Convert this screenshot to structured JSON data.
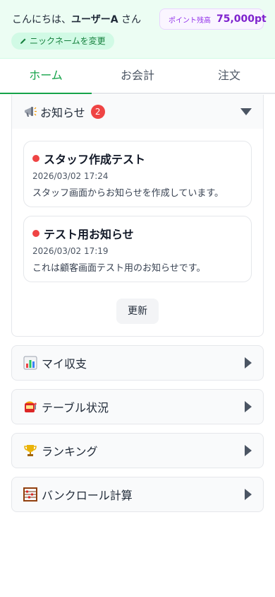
{
  "header": {
    "greeting_prefix": "こんにちは、",
    "user_name": "ユーザーA",
    "greeting_suffix": " さん",
    "nickname_button": "ニックネームを変更",
    "points_label": "ポイント残高",
    "points_value": "75,000pt"
  },
  "tabs": [
    {
      "label": "ホーム",
      "active": true
    },
    {
      "label": "お会計",
      "active": false
    },
    {
      "label": "注文",
      "active": false
    }
  ],
  "notices": {
    "title": "お知らせ",
    "count": "2",
    "items": [
      {
        "title": "スタッフ作成テスト",
        "date": "2026/03/02 17:24",
        "body": "スタッフ画面からお知らせを作成しています。"
      },
      {
        "title": "テスト用お知らせ",
        "date": "2026/03/02 17:19",
        "body": "これは顧客画面テスト用のお知らせです。"
      }
    ],
    "refresh_label": "更新"
  },
  "menu": [
    {
      "icon": "bar-chart-icon",
      "label": "マイ収支"
    },
    {
      "icon": "slot-machine-icon",
      "label": "テーブル状況"
    },
    {
      "icon": "trophy-icon",
      "label": "ランキング"
    },
    {
      "icon": "abacus-icon",
      "label": "バンクロール計算"
    }
  ],
  "colors": {
    "accent": "#16a34a",
    "points": "#7e22ce",
    "badge": "#ef4444"
  }
}
